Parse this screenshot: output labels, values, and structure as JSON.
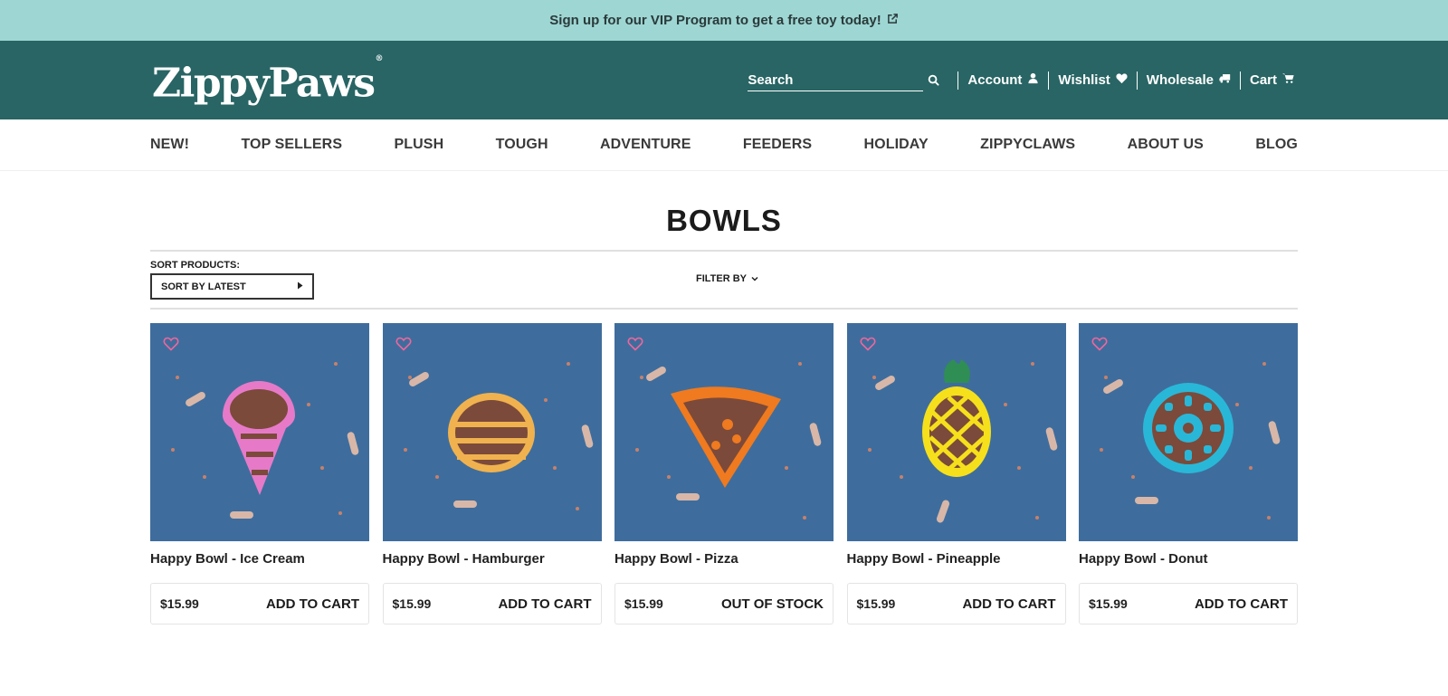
{
  "promo": {
    "text": "Sign up for our VIP Program to get a free toy today!",
    "icon": "external-link-icon"
  },
  "header": {
    "logo": "ZippyPaws",
    "logo_mark": "®",
    "search_placeholder": "Search",
    "links": [
      {
        "label": "Account",
        "icon": "user-icon"
      },
      {
        "label": "Wishlist",
        "icon": "heart-icon"
      },
      {
        "label": "Wholesale",
        "icon": "truck-icon"
      },
      {
        "label": "Cart",
        "icon": "cart-icon"
      }
    ]
  },
  "nav": [
    "NEW!",
    "TOP SELLERS",
    "PLUSH",
    "TOUGH",
    "ADVENTURE",
    "FEEDERS",
    "HOLIDAY",
    "ZIPPYCLAWS",
    "ABOUT US",
    "BLOG"
  ],
  "page": {
    "title": "BOWLS",
    "sort_label": "SORT PRODUCTS:",
    "sort_value": "SORT BY LATEST",
    "filter_label": "FILTER BY"
  },
  "products": [
    {
      "name": "Happy Bowl - Ice Cream",
      "price": "$15.99",
      "action": "ADD TO CART",
      "bowl_color": "#e67ac8"
    },
    {
      "name": "Happy Bowl - Hamburger",
      "price": "$15.99",
      "action": "ADD TO CART",
      "bowl_color": "#f0b24e"
    },
    {
      "name": "Happy Bowl - Pizza",
      "price": "$15.99",
      "action": "OUT OF STOCK",
      "bowl_color": "#f07a1f"
    },
    {
      "name": "Happy Bowl - Pineapple",
      "price": "$15.99",
      "action": "ADD TO CART",
      "bowl_color": "#f6e01c"
    },
    {
      "name": "Happy Bowl - Donut",
      "price": "$15.99",
      "action": "ADD TO CART",
      "bowl_color": "#29b7d8"
    }
  ],
  "colors": {
    "promo_bg": "#9ed6d3",
    "header_bg": "#286564",
    "product_bg": "#3e6d9d",
    "wishlist_heart": "#f0669c"
  }
}
